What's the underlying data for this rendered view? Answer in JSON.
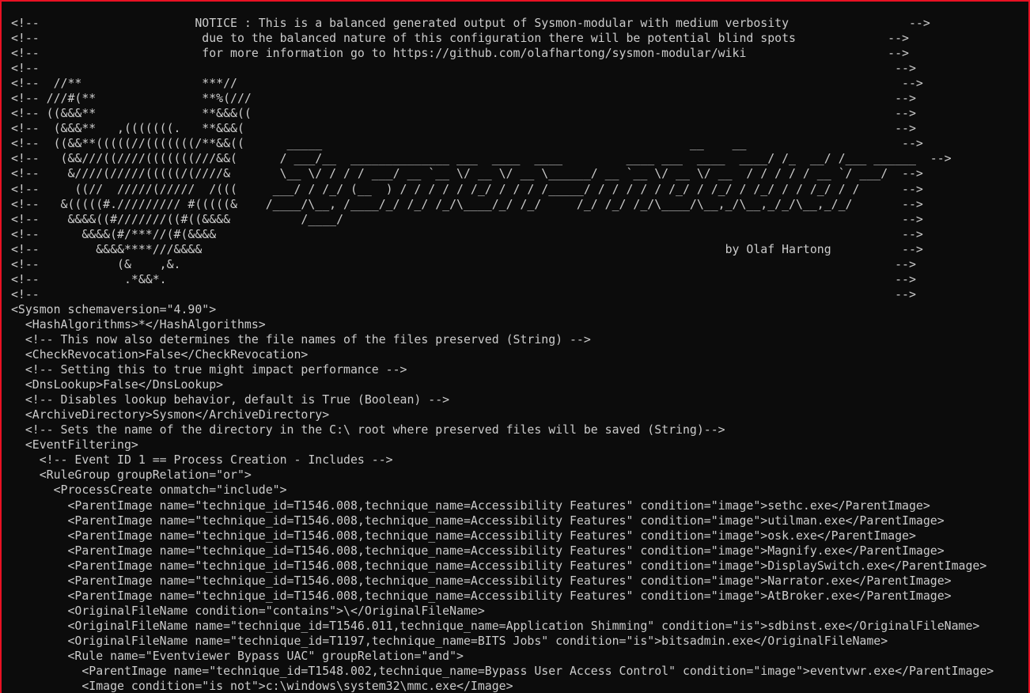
{
  "window": {
    "frame_color": "#e81123",
    "background_color": "#0c0c0c",
    "text_color": "#cccccc"
  },
  "console": {
    "lines": [
      "<!--                      NOTICE : This is a balanced generated output of Sysmon-modular with medium verbosity                 -->",
      "<!--                       due to the balanced nature of this configuration there will be potential blind spots             -->",
      "<!--                       for more information go to https://github.com/olafhartong/sysmon-modular/wiki                    -->",
      "<!--                                                                                                                         -->",
      "<!--  //**                 ***//                                                                                              -->",
      "<!-- ///#(**               **%(///                                                                                           -->",
      "<!-- ((&&&**               **&&&((                                                                                           -->",
      "<!--  (&&&**   ,(((((((.   **&&&(                                                                                            -->",
      "<!--  ((&&**(((((//(((((((/**&&((      _____                                                    __    __                      -->",
      "<!--   (&&///((////(((((((///&&(      / ___/__  ______________ ___  ____  ____         ____ ___  ____  ____/ /_  __/ /___ ______  -->",
      "<!--    &////(/////(((((/(////&       \\__ \\/ / / / ___/ __ `__ \\/ __ \\/ __ \\______/ __ `__ \\/ __ \\/ __  / / / / / __ `/ ___/  -->",
      "<!--     ((//  /////(/////  /(((     ___/ / /_/ (__  ) / / / / / /_/ / / / /_____/ / / / / / /_/ / /_/ / /_/ / / /_/ / /      -->",
      "<!--   &(((((#.///////// #(((((&    /____/\\__, /____/_/ /_/ /_/\\____/_/ /_/     /_/ /_/ /_/\\____/\\__,_/\\__,_/_/\\__,_/_/       -->",
      "<!--    &&&&((#///////((#((&&&&          /____/                                                                               -->",
      "<!--      &&&&(#/***//(#(&&&&                                                                                                 -->",
      "<!--        &&&&****///&&&&                                                                          by Olaf Hartong          -->",
      "<!--           (&    ,&.                                                                                                     -->",
      "<!--            .*&&*.                                                                                                       -->",
      "<!--                                                                                                                         -->",
      "<Sysmon schemaversion=\"4.90\">",
      "  <HashAlgorithms>*</HashAlgorithms>",
      "  <!-- This now also determines the file names of the files preserved (String) -->",
      "  <CheckRevocation>False</CheckRevocation>",
      "  <!-- Setting this to true might impact performance -->",
      "  <DnsLookup>False</DnsLookup>",
      "  <!-- Disables lookup behavior, default is True (Boolean) -->",
      "  <ArchiveDirectory>Sysmon</ArchiveDirectory>",
      "  <!-- Sets the name of the directory in the C:\\ root where preserved files will be saved (String)-->",
      "  <EventFiltering>",
      "    <!-- Event ID 1 == Process Creation - Includes -->",
      "    <RuleGroup groupRelation=\"or\">",
      "      <ProcessCreate onmatch=\"include\">",
      "        <ParentImage name=\"technique_id=T1546.008,technique_name=Accessibility Features\" condition=\"image\">sethc.exe</ParentImage>",
      "        <ParentImage name=\"technique_id=T1546.008,technique_name=Accessibility Features\" condition=\"image\">utilman.exe</ParentImage>",
      "        <ParentImage name=\"technique_id=T1546.008,technique_name=Accessibility Features\" condition=\"image\">osk.exe</ParentImage>",
      "        <ParentImage name=\"technique_id=T1546.008,technique_name=Accessibility Features\" condition=\"image\">Magnify.exe</ParentImage>",
      "        <ParentImage name=\"technique_id=T1546.008,technique_name=Accessibility Features\" condition=\"image\">DisplaySwitch.exe</ParentImage>",
      "        <ParentImage name=\"technique_id=T1546.008,technique_name=Accessibility Features\" condition=\"image\">Narrator.exe</ParentImage>",
      "        <ParentImage name=\"technique_id=T1546.008,technique_name=Accessibility Features\" condition=\"image\">AtBroker.exe</ParentImage>",
      "        <OriginalFileName condition=\"contains\">\\</OriginalFileName>",
      "        <OriginalFileName name=\"technique_id=T1546.011,technique_name=Application Shimming\" condition=\"is\">sdbinst.exe</OriginalFileName>",
      "        <OriginalFileName name=\"technique_id=T1197,technique_name=BITS Jobs\" condition=\"is\">bitsadmin.exe</OriginalFileName>",
      "        <Rule name=\"Eventviewer Bypass UAC\" groupRelation=\"and\">",
      "          <ParentImage name=\"technique_id=T1548.002,technique_name=Bypass User Access Control\" condition=\"image\">eventvwr.exe</ParentImage>",
      "          <Image condition=\"is not\">c:\\windows\\system32\\mmc.exe</Image>"
    ]
  }
}
